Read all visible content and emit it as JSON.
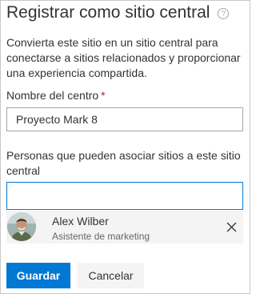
{
  "panel": {
    "title": "Registrar como sitio central",
    "help_icon_glyph": "?",
    "description": "Convierta este sitio en un sitio central para conectarse a sitios relacionados y proporcionar una experiencia compartida."
  },
  "hub_name": {
    "label": "Nombre del centro",
    "required_marker": "*",
    "value": "Proyecto Mark 8"
  },
  "associate_people": {
    "label": "Personas que pueden asociar sitios a este sitio central",
    "value": ""
  },
  "selected_person": {
    "name": "Alex Wilber",
    "role": "Asistente de marketing",
    "avatar_icon": "user-photo",
    "remove_icon": "close-icon"
  },
  "actions": {
    "save_label": "Guardar",
    "cancel_label": "Cancelar"
  },
  "colors": {
    "accent": "#0078d4",
    "required": "#a4262c",
    "persona_background": "#f4f4f4"
  }
}
